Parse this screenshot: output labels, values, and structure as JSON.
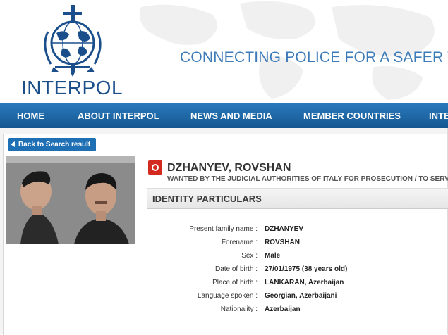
{
  "header": {
    "brand": "INTERPOL",
    "tagline": "CONNECTING POLICE FOR A SAFER WO",
    "accent": "#1b4f8c"
  },
  "nav": {
    "items": [
      {
        "label": "HOME"
      },
      {
        "label": "ABOUT INTERPOL"
      },
      {
        "label": "NEWS AND MEDIA"
      },
      {
        "label": "MEMBER COUNTRIES"
      },
      {
        "label": "INTE"
      }
    ],
    "bg_color": "#1f6fb5"
  },
  "back_button": {
    "label": "Back to Search result"
  },
  "notice": {
    "icon": "red-notice-icon",
    "name": "DZHANYEV, ROVSHAN",
    "wanted_by": "WANTED BY THE JUDICIAL AUTHORITIES OF ITALY FOR PROSECUTION / TO SERV"
  },
  "identity": {
    "title": "IDENTITY PARTICULARS",
    "rows": [
      {
        "label": "Present family name :",
        "value": "DZHANYEV"
      },
      {
        "label": "Forename :",
        "value": "ROVSHAN"
      },
      {
        "label": "Sex :",
        "value": "Male"
      },
      {
        "label": "Date of birth :",
        "value": "27/01/1975 (38 years old)"
      },
      {
        "label": "Place of birth :",
        "value": "LANKARAN, Azerbaijan"
      },
      {
        "label": "Language spoken :",
        "value": "Georgian, Azerbaijani"
      },
      {
        "label": "Nationality :",
        "value": "Azerbaijan"
      }
    ]
  }
}
